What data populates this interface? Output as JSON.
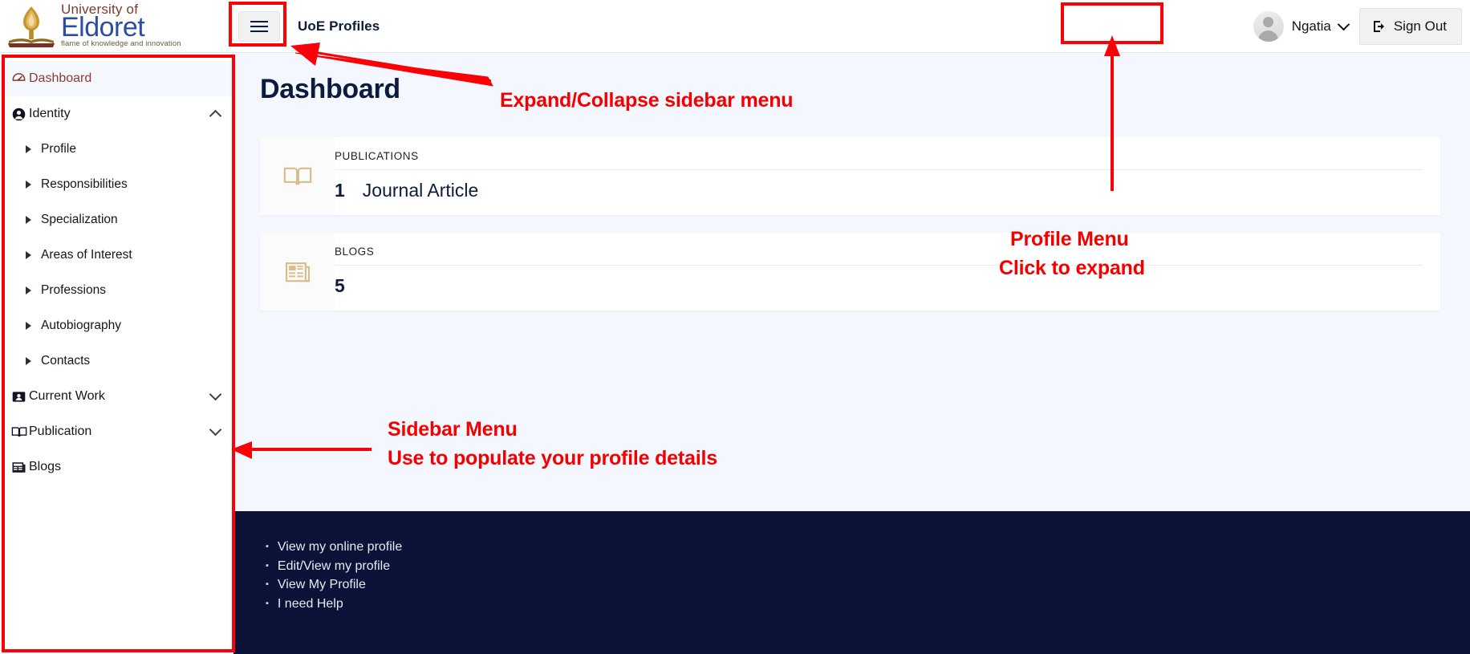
{
  "header": {
    "brand": {
      "university": "University of",
      "name": "Eldoret",
      "tagline": "flame of knowledge and innovation",
      "logo_icon": "torch-book-logo"
    },
    "menu_toggle_icon": "hamburger-icon",
    "app_title": "UoE Profiles",
    "profile": {
      "name": "Ngatia",
      "avatar_icon": "user-avatar-icon",
      "chevron_icon": "chevron-down-icon"
    },
    "sign_out": {
      "label": "Sign Out",
      "icon": "sign-out-icon"
    }
  },
  "sidebar": {
    "items": [
      {
        "label": "Dashboard",
        "icon": "speedometer-icon",
        "active": true
      },
      {
        "label": "Identity",
        "icon": "user-circle-icon",
        "caret": "chevron-up-icon"
      },
      {
        "label": "Current Work",
        "icon": "id-card-icon",
        "caret": "chevron-down-icon"
      },
      {
        "label": "Publication",
        "icon": "book-open-icon",
        "caret": "chevron-down-icon"
      },
      {
        "label": "Blogs",
        "icon": "newspaper-icon"
      }
    ],
    "identity_children": [
      {
        "label": "Profile",
        "icon": "triangle-right-icon"
      },
      {
        "label": "Responsibilities",
        "icon": "triangle-right-icon"
      },
      {
        "label": "Specialization",
        "icon": "triangle-right-icon"
      },
      {
        "label": "Areas of Interest",
        "icon": "triangle-right-icon"
      },
      {
        "label": "Professions",
        "icon": "triangle-right-icon"
      },
      {
        "label": "Autobiography",
        "icon": "triangle-right-icon"
      },
      {
        "label": "Contacts",
        "icon": "triangle-right-icon"
      }
    ]
  },
  "main": {
    "page_title": "Dashboard",
    "cards": [
      {
        "label": "PUBLICATIONS",
        "count": "1",
        "subtitle": "Journal Article",
        "icon": "book-open-icon"
      },
      {
        "label": "BLOGS",
        "count": "5",
        "subtitle": "",
        "icon": "newspaper-icon"
      }
    ]
  },
  "footer": {
    "links": [
      "View my online profile",
      "Edit/View my profile",
      "View My Profile",
      "I need Help"
    ]
  },
  "annotations": [
    {
      "id": "sidebar-toggle",
      "text": "Expand/Collapse sidebar menu"
    },
    {
      "id": "profile-menu-1",
      "text": "Profile Menu"
    },
    {
      "id": "profile-menu-2",
      "text": "Click to expand"
    },
    {
      "id": "sidebar-menu-1",
      "text": "Sidebar Menu"
    },
    {
      "id": "sidebar-menu-2",
      "text": "Use to populate your profile details"
    }
  ],
  "colors": {
    "annotation": "#f50000",
    "brand_blue": "#2b4ea2",
    "brand_maroon": "#7a3b2e",
    "footer_navy": "#0a1238",
    "card_icon_gold": "#d9bd8a",
    "page_bg": "#f4f7fd"
  }
}
